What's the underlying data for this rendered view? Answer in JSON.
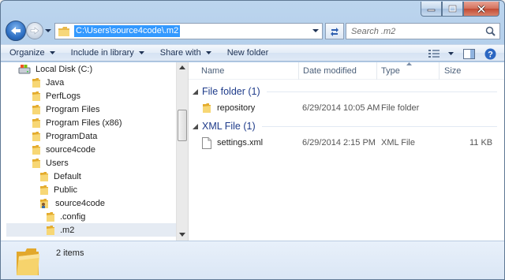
{
  "window": {
    "caption": {
      "minimize": "minimize",
      "maximize": "maximize",
      "close": "close"
    }
  },
  "address_bar": {
    "path": "C:\\Users\\source4code\\.m2",
    "search_placeholder": "Search .m2"
  },
  "toolbar": {
    "organize": "Organize",
    "include_in_library": "Include in library",
    "share_with": "Share with",
    "new_folder": "New folder"
  },
  "nav_tree": {
    "items": [
      {
        "label": "Local Disk (C:)",
        "icon": "drive-icon"
      },
      {
        "label": "Java",
        "icon": "folder-icon"
      },
      {
        "label": "PerfLogs",
        "icon": "folder-icon"
      },
      {
        "label": "Program Files",
        "icon": "folder-icon"
      },
      {
        "label": "Program Files (x86)",
        "icon": "folder-icon"
      },
      {
        "label": "ProgramData",
        "icon": "folder-icon"
      },
      {
        "label": "source4code",
        "icon": "folder-icon"
      },
      {
        "label": "Users",
        "icon": "folder-icon"
      },
      {
        "label": "Default",
        "icon": "folder-icon"
      },
      {
        "label": "Public",
        "icon": "folder-icon"
      },
      {
        "label": "source4code",
        "icon": "user-folder-icon"
      },
      {
        "label": ".config",
        "icon": "folder-icon"
      },
      {
        "label": ".m2",
        "icon": "folder-icon",
        "selected": true
      }
    ]
  },
  "columns": {
    "name": "Name",
    "date_modified": "Date modified",
    "type": "Type",
    "size": "Size"
  },
  "groups": [
    {
      "label": "File folder (1)",
      "items": [
        {
          "name": "repository",
          "date": "6/29/2014 10:05 AM",
          "type": "File folder",
          "size": "",
          "icon": "folder-icon"
        }
      ]
    },
    {
      "label": "XML File (1)",
      "items": [
        {
          "name": "settings.xml",
          "date": "6/29/2014 2:15 PM",
          "type": "XML File",
          "size": "11 KB",
          "icon": "xml-file-icon"
        }
      ]
    }
  ],
  "details": {
    "item_count": "2 items"
  },
  "colors": {
    "selection": "#3399ff",
    "group_header": "#1e3b8a",
    "folder_yellow": "#f2c94c",
    "chrome_blue": "#bcd5ee"
  }
}
